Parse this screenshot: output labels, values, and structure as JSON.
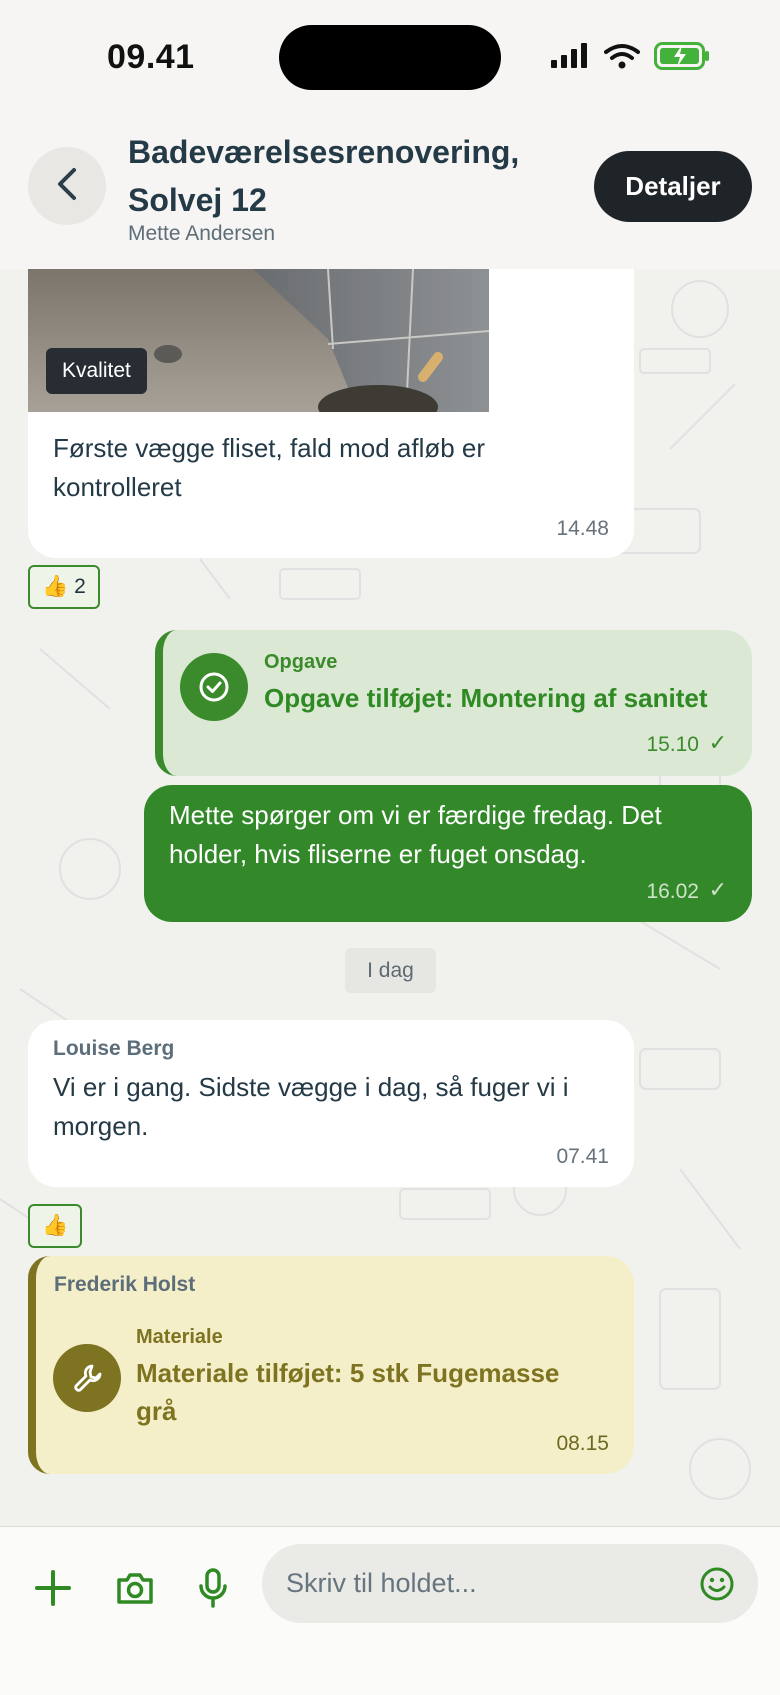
{
  "status_bar": {
    "time": "09.41"
  },
  "header": {
    "title": "Badeværelsesrenovering, Solvej 12",
    "subtitle": "Mette Andersen",
    "details_label": "Detaljer"
  },
  "messages": [
    {
      "type": "photo-message",
      "tag": "Kvalitet",
      "text": "Første vægge fliset, fald mod afløb er kontrolleret",
      "time": "14.48",
      "reaction": "👍",
      "reaction_count": "2"
    },
    {
      "type": "task",
      "kind": "Opgave",
      "title": "Opgave tilføjet: Montering af sanitet",
      "time": "15.10",
      "check": "✓"
    },
    {
      "type": "outgoing",
      "text": "Mette spørger om vi er færdige fredag. Det holder, hvis fliserne er fuget onsdag.",
      "time": "16.02",
      "check": "✓"
    },
    {
      "type": "date-separator",
      "text": "I dag"
    },
    {
      "type": "incoming",
      "sender": "Louise Berg",
      "text": "Vi er i gang. Sidste vægge i dag, så fuger vi i morgen.",
      "time": "07.41",
      "reaction": "👍"
    },
    {
      "type": "material",
      "sender": "Frederik Holst",
      "kind": "Materiale",
      "title": "Materiale tilføjet: 5 stk Fugemasse grå",
      "time": "08.15"
    }
  ],
  "composer": {
    "placeholder": "Skriv til holdet..."
  },
  "colors": {
    "accent_green": "#33892a",
    "task_bg": "#dbe9d4",
    "material_bg": "#f4efc9",
    "material_accent": "#7d7320",
    "header_bg": "#f6f5f3"
  },
  "icons": [
    "signal-icon",
    "wifi-icon",
    "battery-icon",
    "back-chevron-icon",
    "check-circle-icon",
    "wrench-icon",
    "plus-icon",
    "camera-icon",
    "microphone-icon",
    "emoji-icon"
  ]
}
